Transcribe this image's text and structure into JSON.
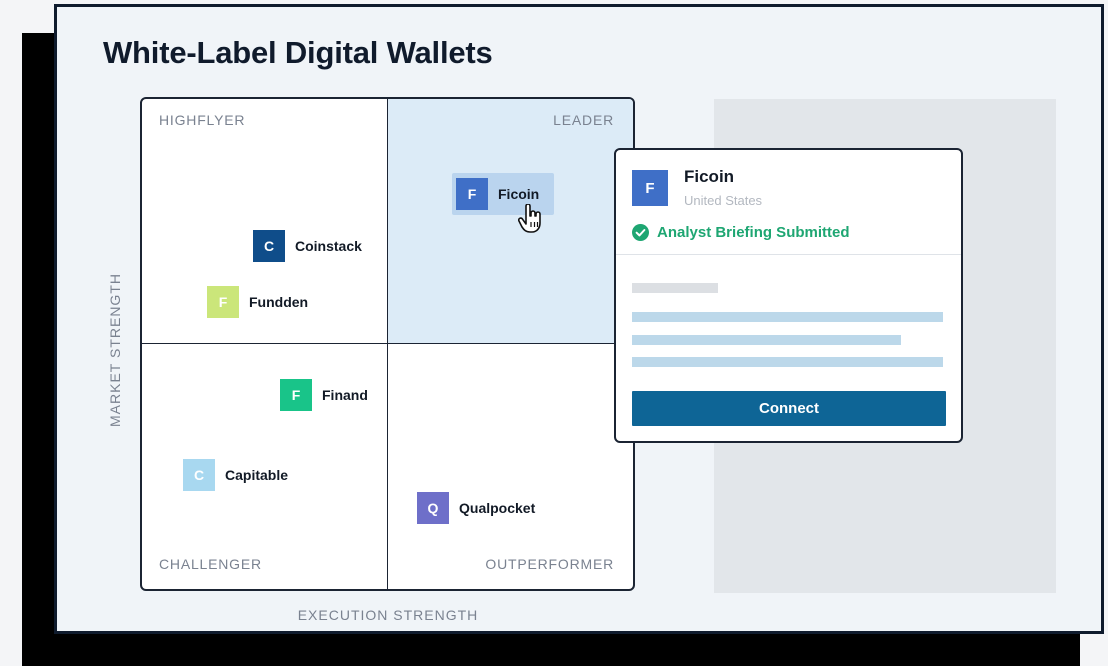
{
  "title": "White-Label Digital Wallets",
  "axes": {
    "y_label": "MARKET STRENGTH",
    "x_label": "EXECUTION STRENGTH"
  },
  "quadrants": {
    "top_left": "HIGHFLYER",
    "top_right": "LEADER",
    "bottom_left": "CHALLENGER",
    "bottom_right": "OUTPERFORMER"
  },
  "vendors": {
    "ficoin": {
      "name": "Ficoin",
      "initial": "F",
      "color": "#3f6fc7"
    },
    "coinstack": {
      "name": "Coinstack",
      "initial": "C",
      "color": "#0f4d8a"
    },
    "fundden": {
      "name": "Fundden",
      "initial": "F",
      "color": "#cbe67a"
    },
    "finand": {
      "name": "Finand",
      "initial": "F",
      "color": "#19c489"
    },
    "capitable": {
      "name": "Capitable",
      "initial": "C",
      "color": "#a8d8f0"
    },
    "qualpocket": {
      "name": "Qualpocket",
      "initial": "Q",
      "color": "#6e6fc9"
    }
  },
  "popup": {
    "initial": "F",
    "name": "Ficoin",
    "country": "United States",
    "status": "Analyst Briefing Submitted",
    "button": "Connect"
  },
  "colors": {
    "leader_bg": "#dcebf7",
    "status_green": "#1ea672",
    "button_blue": "#0e6596",
    "placeholder_gray": "#dcdfe3",
    "placeholder_blue": "#bcd8ea"
  },
  "icons": {
    "cursor": "hand-pointer-icon",
    "status": "check-circle-icon"
  }
}
